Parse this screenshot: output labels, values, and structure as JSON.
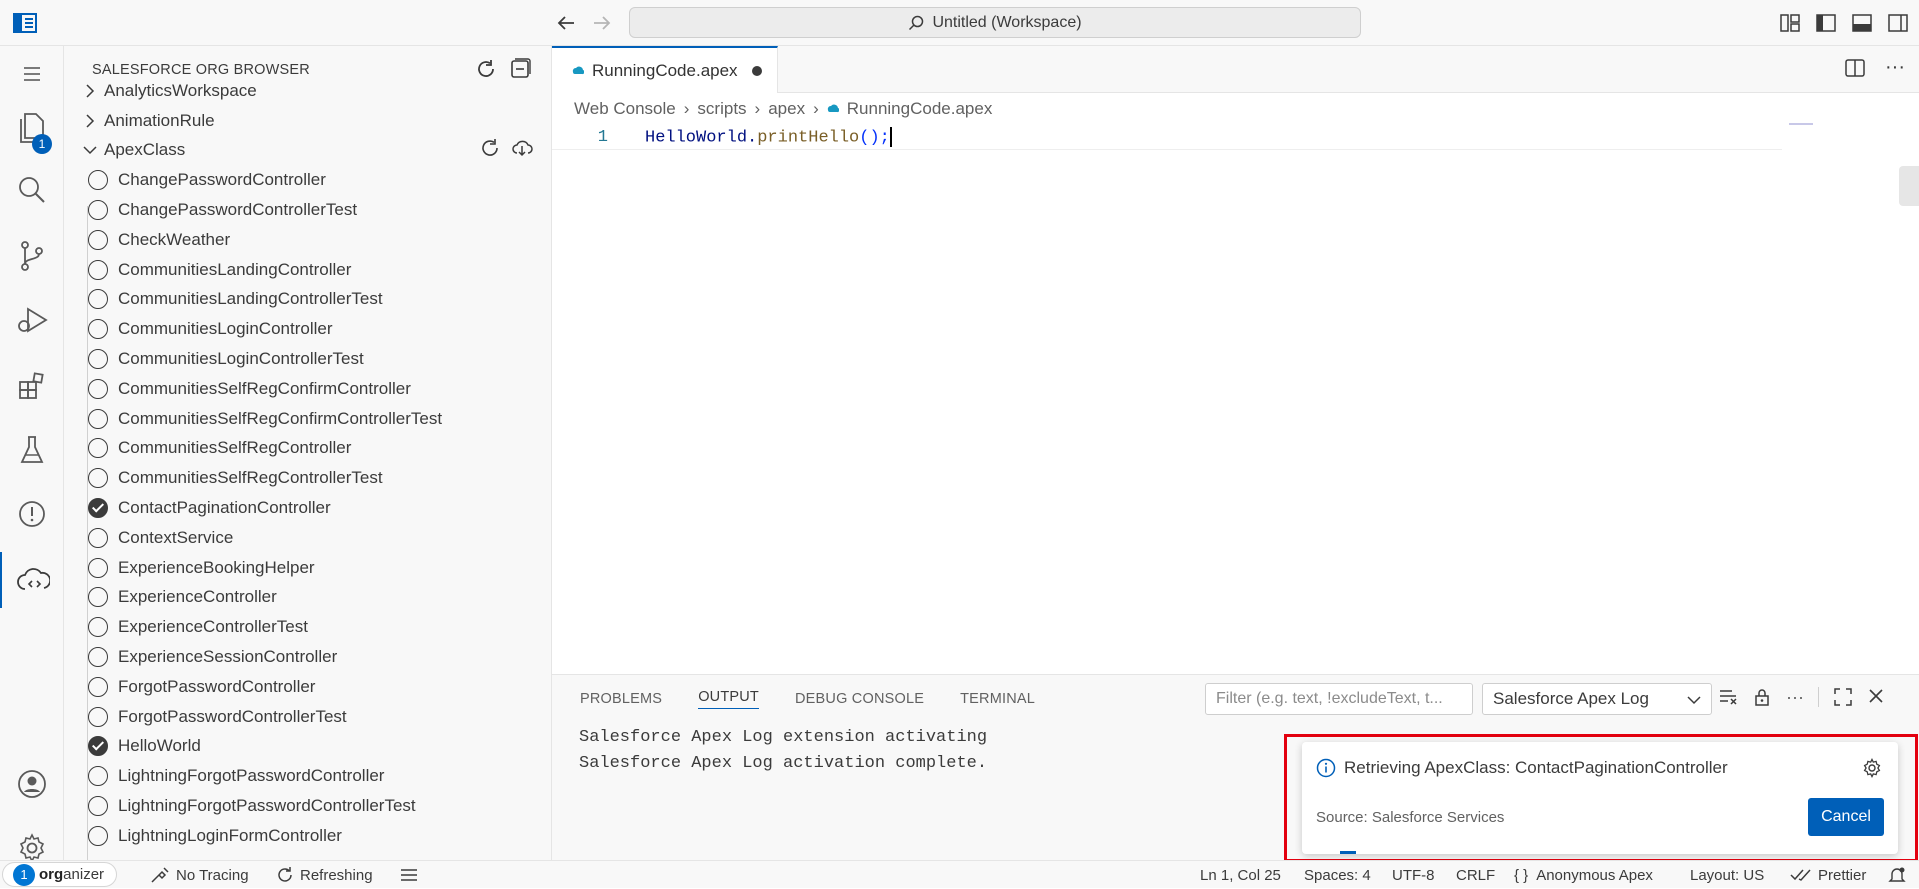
{
  "titlebar": {
    "command_center": "Untitled (Workspace)",
    "logo_icon": "sidebar-layout-icon",
    "back_icon": "arrow-left-icon",
    "forward_icon": "arrow-right-icon"
  },
  "activity_bar": {
    "explorer_badge": "1"
  },
  "sidebar": {
    "title": "SALESFORCE ORG BROWSER",
    "tree": [
      {
        "label": "AnalyticsWorkspace",
        "type": "folder",
        "expanded": false
      },
      {
        "label": "AnimationRule",
        "type": "folder",
        "expanded": false
      },
      {
        "label": "ApexClass",
        "type": "folder",
        "expanded": true
      }
    ],
    "apex_classes": [
      {
        "label": "ChangePasswordController",
        "checked": false
      },
      {
        "label": "ChangePasswordControllerTest",
        "checked": false
      },
      {
        "label": "CheckWeather",
        "checked": false
      },
      {
        "label": "CommunitiesLandingController",
        "checked": false
      },
      {
        "label": "CommunitiesLandingControllerTest",
        "checked": false
      },
      {
        "label": "CommunitiesLoginController",
        "checked": false
      },
      {
        "label": "CommunitiesLoginControllerTest",
        "checked": false
      },
      {
        "label": "CommunitiesSelfRegConfirmController",
        "checked": false
      },
      {
        "label": "CommunitiesSelfRegConfirmControllerTest",
        "checked": false
      },
      {
        "label": "CommunitiesSelfRegController",
        "checked": false
      },
      {
        "label": "CommunitiesSelfRegControllerTest",
        "checked": false
      },
      {
        "label": "ContactPaginationController",
        "checked": true
      },
      {
        "label": "ContextService",
        "checked": false
      },
      {
        "label": "ExperienceBookingHelper",
        "checked": false
      },
      {
        "label": "ExperienceController",
        "checked": false
      },
      {
        "label": "ExperienceControllerTest",
        "checked": false
      },
      {
        "label": "ExperienceSessionController",
        "checked": false
      },
      {
        "label": "ForgotPasswordController",
        "checked": false
      },
      {
        "label": "ForgotPasswordControllerTest",
        "checked": false
      },
      {
        "label": "HelloWorld",
        "checked": true
      },
      {
        "label": "LightningForgotPasswordController",
        "checked": false
      },
      {
        "label": "LightningForgotPasswordControllerTest",
        "checked": false
      },
      {
        "label": "LightningLoginFormController",
        "checked": false
      }
    ]
  },
  "editor": {
    "tab_label": "RunningCode.apex",
    "breadcrumb": [
      "Web Console",
      "scripts",
      "apex",
      "RunningCode.apex"
    ],
    "line_number": "1",
    "code_obj": "HelloWorld",
    "code_dot": ".",
    "code_fn": "printHello",
    "code_tail": "();"
  },
  "panel": {
    "tabs": [
      "PROBLEMS",
      "OUTPUT",
      "DEBUG CONSOLE",
      "TERMINAL"
    ],
    "active_tab": "OUTPUT",
    "filter_placeholder": "Filter (e.g. text, !excludeText, t...",
    "channel": "Salesforce Apex Log",
    "output_lines": [
      "Salesforce Apex Log extension activating",
      "Salesforce Apex Log activation complete."
    ]
  },
  "notification": {
    "message": "Retrieving ApexClass: ContactPaginationController",
    "source": "Source: Salesforce Services",
    "cancel_label": "Cancel",
    "highlight_color": "#e3000f"
  },
  "statusbar": {
    "org_prefix": "org",
    "org_suffix": "anizer",
    "tracing": "No Tracing",
    "refreshing": "Refreshing",
    "position": "Ln 1, Col 25",
    "spaces": "Spaces: 4",
    "encoding": "UTF-8",
    "eol": "CRLF",
    "language": "Anonymous Apex",
    "layout": "Layout: US",
    "formatter": "Prettier"
  },
  "colors": {
    "accent": "#005fb8",
    "salesforce_blue": "#0176d3"
  }
}
